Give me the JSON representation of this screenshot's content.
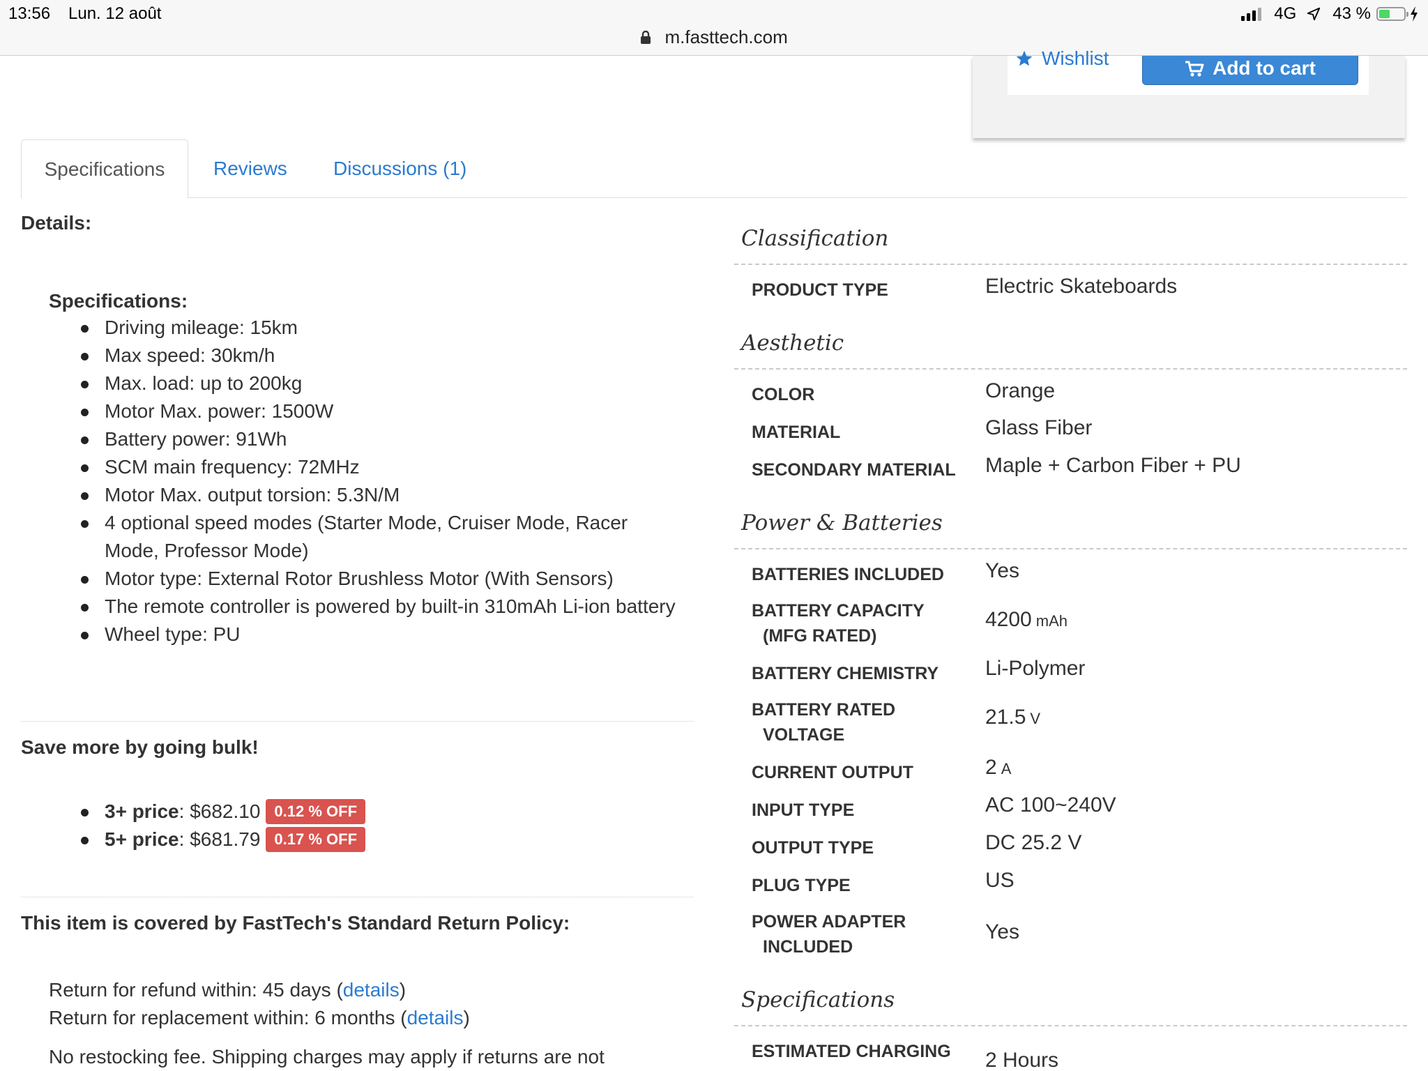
{
  "status_bar": {
    "time": "13:56",
    "date": "Lun. 12 août",
    "network": "4G",
    "battery_percent": "43 %",
    "battery_level": 0.43,
    "url": "m.fasttech.com"
  },
  "cart_card": {
    "wishlist_label": "Wishlist",
    "add_to_cart_label": "Add to cart"
  },
  "tabs": [
    {
      "label": "Specifications",
      "active": true
    },
    {
      "label": "Reviews",
      "active": false
    },
    {
      "label": "Discussions (1)",
      "active": false
    }
  ],
  "details": {
    "title": "Details:",
    "specs_title": "Specifications:",
    "specs": [
      "Driving mileage: 15km",
      "Max speed: 30km/h",
      "Max. load: up to 200kg",
      "Motor Max. power: 1500W",
      "Battery power: 91Wh",
      "SCM main frequency: 72MHz",
      "Motor Max. output torsion: 5.3N/M",
      "4 optional speed modes (Starter Mode, Cruiser Mode, Racer Mode, Professor Mode)",
      "Motor type: External Rotor Brushless Motor (With Sensors)",
      "The remote controller is powered by built-in 310mAh Li-ion battery",
      "Wheel type: PU"
    ]
  },
  "bulk": {
    "title": "Save more by going bulk!",
    "items": [
      {
        "qty": "3+ price",
        "price": ": $682.10",
        "badge": "0.12 % OFF"
      },
      {
        "qty": "5+ price",
        "price": ": $681.79",
        "badge": "0.17 % OFF"
      }
    ]
  },
  "returns": {
    "title": "This item is covered by FastTech's Standard Return Policy:",
    "refund_text": "Return for refund within: 45 days (",
    "replacement_text": "Return for replacement within: 6 months (",
    "details_link": "details",
    "close_paren": ")",
    "note": "No restocking fee. Shipping charges may apply if returns are not"
  },
  "spec_table": {
    "classification": {
      "heading": "Classification",
      "product_type_label": "Product Type",
      "product_type_value": "Electric Skateboards"
    },
    "aesthetic": {
      "heading": "Aesthetic",
      "color_label": "Color",
      "color_value": "Orange",
      "material_label": "Material",
      "material_value": "Glass Fiber",
      "secondary_material_label": "Secondary Material",
      "secondary_material_value": "Maple + Carbon Fiber + PU"
    },
    "power": {
      "heading": "Power & Batteries",
      "batteries_included_label": "Batteries Included",
      "batteries_included_value": "Yes",
      "capacity_label_1": "Battery Capacity",
      "capacity_label_2": "(MFG Rated)",
      "capacity_value": "4200",
      "capacity_unit": "mAh",
      "chemistry_label": "Battery Chemistry",
      "chemistry_value": "Li-Polymer",
      "voltage_label_1": "Battery Rated",
      "voltage_label_2": "Voltage",
      "voltage_value": "21.5",
      "voltage_unit": "V",
      "current_label": "Current Output",
      "current_value": "2",
      "current_unit": "A",
      "input_label": "Input Type",
      "input_value": "AC 100~240V",
      "output_label": "Output Type",
      "output_value": "DC 25.2 V",
      "plug_label": "Plug Type",
      "plug_value": "US",
      "adapter_label_1": "Power Adapter",
      "adapter_label_2": "Included",
      "adapter_value": "Yes"
    },
    "specifications": {
      "heading": "Specifications",
      "charging_label": "Estimated Charging",
      "charging_value": "2 Hours"
    }
  }
}
